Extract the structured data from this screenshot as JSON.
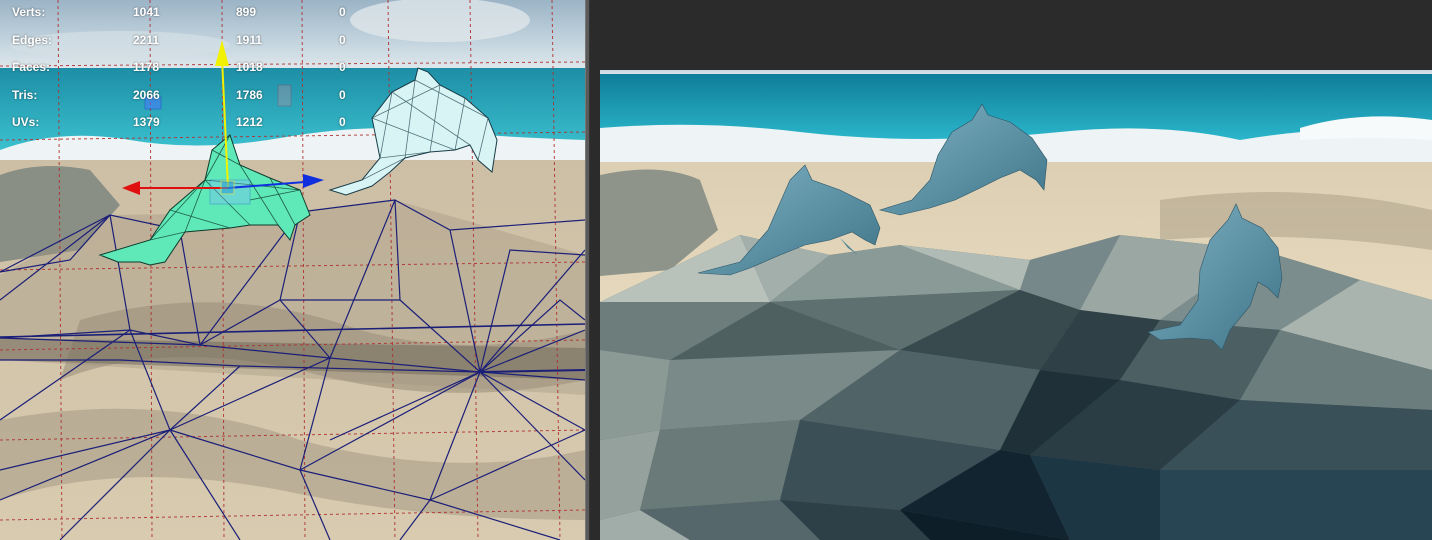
{
  "poly_count_hud": {
    "rows": [
      {
        "label": "Verts:",
        "values": [
          "1041",
          "899",
          "0"
        ]
      },
      {
        "label": "Edges:",
        "values": [
          "2211",
          "1911",
          "0"
        ]
      },
      {
        "label": "Faces:",
        "values": [
          "1178",
          "1018",
          "0"
        ]
      },
      {
        "label": "Tris:",
        "values": [
          "2066",
          "1786",
          "0"
        ]
      },
      {
        "label": "UVs:",
        "values": [
          "1379",
          "1212",
          "0"
        ]
      }
    ]
  },
  "colors": {
    "hud_text": "#ffffff",
    "wireframe": "#1b1f78",
    "grid": "#b03030",
    "selected_mesh": "#5fe8b8",
    "unselected_mesh": "#d8f4f4",
    "axis_y": "#f2f200",
    "axis_x": "#e01010",
    "axis_z": "#1030e0",
    "dolphin_render": "#5f94a8",
    "panel_bg": "#2b2b2b"
  },
  "icons": [
    "move-manipulator-icon",
    "plane-handle-icon",
    "scale-handle-icon"
  ]
}
